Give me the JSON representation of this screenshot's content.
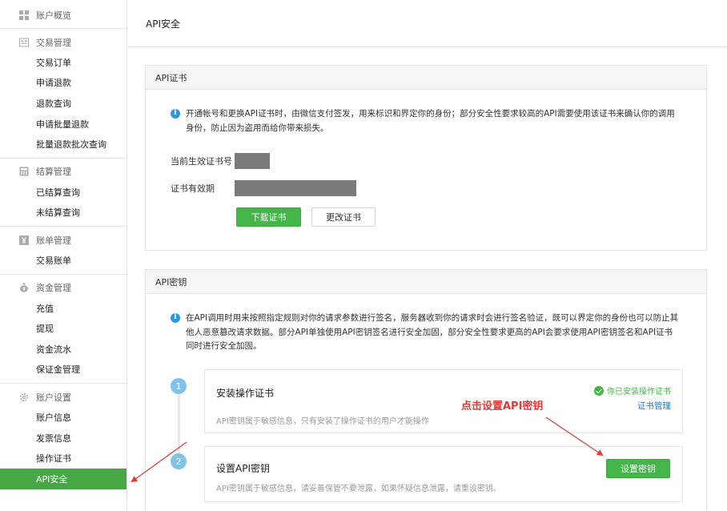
{
  "sidebar": {
    "groups": [
      {
        "title": "账户概览",
        "icon": "grid-icon",
        "items": []
      },
      {
        "title": "交易管理",
        "icon": "receipt-icon",
        "items": [
          "交易订单",
          "申请退款",
          "退款查询",
          "申请批量退款",
          "批量退款批次查询"
        ]
      },
      {
        "title": "结算管理",
        "icon": "calculator-icon",
        "items": [
          "已结算查询",
          "未结算查询"
        ]
      },
      {
        "title": "账单管理",
        "icon": "yen-icon",
        "items": [
          "交易账单"
        ]
      },
      {
        "title": "资金管理",
        "icon": "money-bag-icon",
        "items": [
          "充值",
          "提现",
          "资金流水",
          "保证金管理"
        ]
      },
      {
        "title": "账户设置",
        "icon": "gear-icon",
        "items": [
          "账户信息",
          "发票信息",
          "操作证书",
          "API安全"
        ]
      }
    ],
    "active_item": "API安全"
  },
  "page": {
    "title": "API安全"
  },
  "cert_panel": {
    "title": "API证书",
    "info_line1": "开通帐号和更换API证书时，由微信支付签发，用来标识和界定你的身份；部分安全性要求较高的API需要使用该证书来确认你的调用",
    "info_line2": "身份，防止因为盗用而给你带来损失。",
    "current_cert_label": "当前生效证书号",
    "validity_label": "证书有效期",
    "download_button": "下载证书",
    "change_button": "更改证书"
  },
  "key_panel": {
    "title": "API密钥",
    "info_line1": "在API调用时用来按照指定规则对你的请求参数进行签名，服务器收到你的请求时会进行签名验证，既可以界定你的身份也可以防止其",
    "info_line2": "他人恶意篡改请求数据。部分API单独使用API密钥签名进行安全加固，部分安全性要求更高的API会要求使用API密钥签名和API证书",
    "info_line3": "同时进行安全加固。",
    "steps": [
      {
        "number": "1",
        "title": "安装操作证书",
        "desc": "API密钥属于敏感信息，只有安装了操作证书的用户才能操作",
        "status": "你已安装操作证书",
        "link": "证书管理"
      },
      {
        "number": "2",
        "title": "设置API密钥",
        "desc": "API密钥属于敏感信息，请妥善保管不要泄露，如果怀疑信息泄露，请重设密钥。",
        "button": "设置密钥"
      }
    ]
  },
  "annotation": {
    "text": "点击设置API密钥",
    "color": "#e53935"
  },
  "colors": {
    "accent_green": "#44b549",
    "info_blue": "#2c97de",
    "link_blue": "#2b7bc9"
  }
}
